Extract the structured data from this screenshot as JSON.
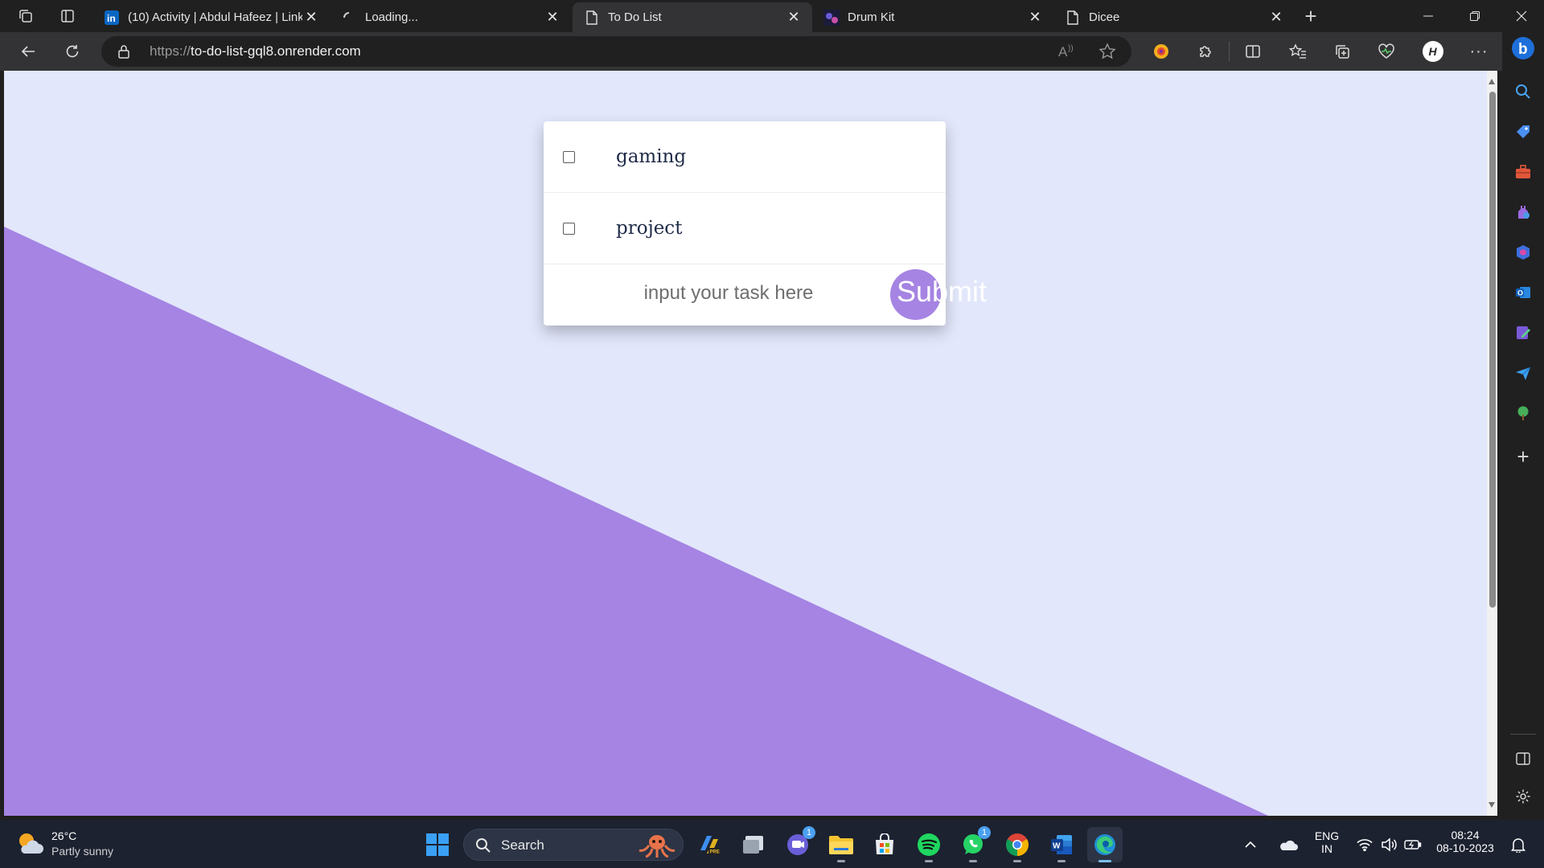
{
  "browser": {
    "tabs": [
      {
        "title": "(10) Activity | Abdul Hafeez | Link",
        "icon": "linkedin-icon",
        "active": false
      },
      {
        "title": "Loading...",
        "icon": "loading-spinner-icon",
        "active": false
      },
      {
        "title": "To Do List",
        "icon": "page-icon",
        "active": true
      },
      {
        "title": "Drum Kit",
        "icon": "drum-kit-favicon-icon",
        "active": false
      },
      {
        "title": "Dicee",
        "icon": "page-icon",
        "active": false
      }
    ],
    "address": {
      "scheme": "https://",
      "host": "to-do-list-gql8.onrender.com"
    }
  },
  "page": {
    "tasks": [
      {
        "label": "gaming",
        "checked": false
      },
      {
        "label": "project",
        "checked": false
      }
    ],
    "input": {
      "value": "",
      "placeholder": "input your task here"
    },
    "submit_label": "Submit",
    "colors": {
      "background": "#e2e7fb",
      "accent": "#a584e3",
      "card": "#ffffff"
    }
  },
  "taskbar": {
    "weather": {
      "temp": "26°C",
      "condition": "Partly sunny"
    },
    "search_label": "Search",
    "whatsapp_badge": "1",
    "teams_badge": "1",
    "language": {
      "line1": "ENG",
      "line2": "IN"
    },
    "clock": {
      "time": "08:24",
      "date": "08-10-2023"
    }
  }
}
